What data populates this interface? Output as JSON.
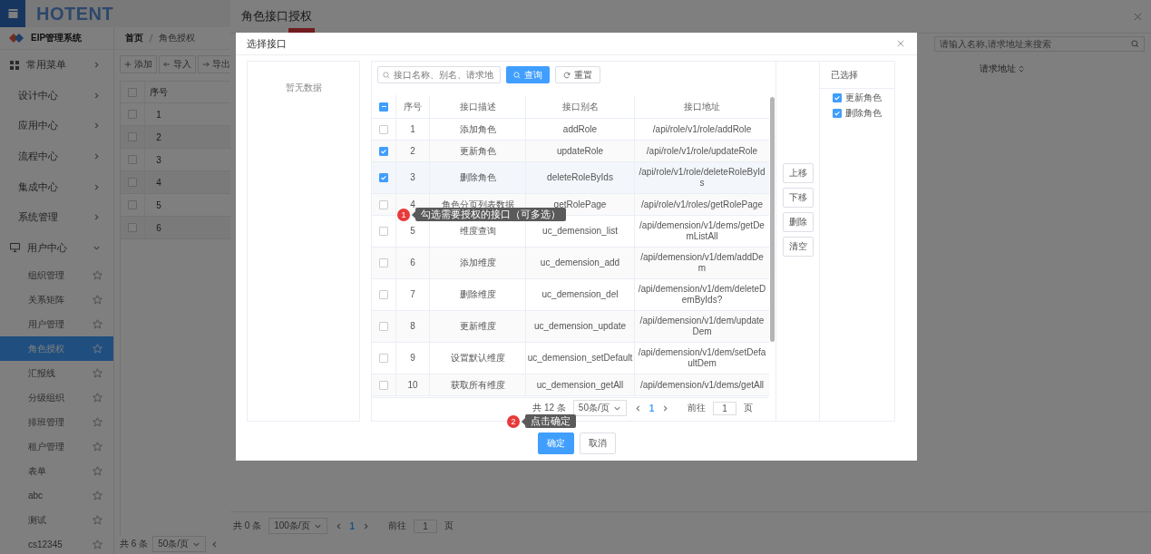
{
  "header": {
    "logo": "HOTENT"
  },
  "sidebar": {
    "system_name": "EIP管理系统",
    "items": [
      {
        "label": "常用菜单",
        "kind": "favorites",
        "expanded": false,
        "selected": false
      },
      {
        "label": "设计中心",
        "kind": "module",
        "expanded": false,
        "selected": false
      },
      {
        "label": "应用中心",
        "kind": "module",
        "expanded": false,
        "selected": false
      },
      {
        "label": "流程中心",
        "kind": "module",
        "expanded": false,
        "selected": false
      },
      {
        "label": "集成中心",
        "kind": "module",
        "expanded": false,
        "selected": false
      },
      {
        "label": "系统管理",
        "kind": "module",
        "expanded": false,
        "selected": false
      },
      {
        "label": "用户中心",
        "kind": "device",
        "expanded": true,
        "selected": false,
        "children": [
          {
            "label": "组织管理",
            "selected": false
          },
          {
            "label": "关系矩阵",
            "selected": false
          },
          {
            "label": "用户管理",
            "selected": false
          },
          {
            "label": "角色授权",
            "selected": true
          },
          {
            "label": "汇报线",
            "selected": false
          },
          {
            "label": "分级组织",
            "selected": false
          },
          {
            "label": "排班管理",
            "selected": false
          },
          {
            "label": "租户管理",
            "selected": false
          },
          {
            "label": "表单",
            "selected": false
          },
          {
            "label": "abc",
            "selected": false
          },
          {
            "label": "测试",
            "selected": false
          },
          {
            "label": "cs12345",
            "selected": false
          }
        ]
      }
    ]
  },
  "main": {
    "breadcrumb": [
      "首页",
      "角色授权"
    ],
    "toolbar": [
      {
        "label": "添加",
        "kind": "add"
      },
      {
        "label": "导入",
        "kind": "import"
      },
      {
        "label": "导出",
        "kind": "export"
      }
    ],
    "table": {
      "columns": [
        "序号"
      ],
      "select_all_checked": false,
      "rows": [
        {
          "index": "1",
          "checked": false
        },
        {
          "index": "2",
          "checked": false
        },
        {
          "index": "3",
          "checked": false
        },
        {
          "index": "4",
          "checked": false
        },
        {
          "index": "5",
          "checked": false
        },
        {
          "index": "6",
          "checked": false
        }
      ]
    },
    "pagination": {
      "total": "共 6 条",
      "page_size": "50条/页"
    }
  },
  "drawer": {
    "title": "角色接口授权",
    "search": {
      "placeholder": "请输入名称,请求地址来搜索"
    },
    "columns": [
      {
        "label": "请求地址",
        "sortable": true
      }
    ],
    "pagination": {
      "total": "共 0 条",
      "page_size": "100条/页",
      "current_page": "1",
      "goto_label": "前往",
      "goto_value": "1",
      "page_unit": "页"
    }
  },
  "dialog": {
    "title": "选择接口",
    "left_panel": {
      "empty_text": "暂无数据"
    },
    "search": {
      "placeholder": "接口名称、别名、请求地"
    },
    "query_button": "查询",
    "reset_button": "重置",
    "table": {
      "select_all_indeterminate": true,
      "columns": [
        "序号",
        "接口描述",
        "接口别名",
        "接口地址"
      ],
      "rows": [
        {
          "index": "1",
          "description": "添加角色",
          "alias": "addRole",
          "address": "/api/role/v1/role/addRole",
          "checked": false
        },
        {
          "index": "2",
          "description": "更新角色",
          "alias": "updateRole",
          "address": "/api/role/v1/role/updateRole",
          "checked": true
        },
        {
          "index": "3",
          "description": "删除角色",
          "alias": "deleteRoleByIds",
          "address": "/api/role/v1/role/deleteRoleByIds",
          "checked": true
        },
        {
          "index": "4",
          "description": "角色分页列表数据",
          "alias": "getRolePage",
          "address": "/api/role/v1/roles/getRolePage",
          "checked": false
        },
        {
          "index": "5",
          "description": "维度查询",
          "alias": "uc_demension_list",
          "address": "/api/demension/v1/dems/getDemListAll",
          "checked": false
        },
        {
          "index": "6",
          "description": "添加维度",
          "alias": "uc_demension_add",
          "address": "/api/demension/v1/dem/addDem",
          "checked": false
        },
        {
          "index": "7",
          "description": "删除维度",
          "alias": "uc_demension_del",
          "address": "/api/demension/v1/dem/deleteDemByIds?",
          "checked": false
        },
        {
          "index": "8",
          "description": "更新维度",
          "alias": "uc_demension_update",
          "address": "/api/demension/v1/dem/updateDem",
          "checked": false
        },
        {
          "index": "9",
          "description": "设置默认维度",
          "alias": "uc_demension_setDefault",
          "address": "/api/demension/v1/dem/setDefaultDem",
          "checked": false
        },
        {
          "index": "10",
          "description": "获取所有维度",
          "alias": "uc_demension_getAll",
          "address": "/api/demension/v1/dems/getAll",
          "checked": false
        }
      ]
    },
    "pagination": {
      "total": "共 12 条",
      "page_size": "50条/页",
      "current_page": "1",
      "goto_label": "前往",
      "goto_value": "1",
      "page_unit": "页"
    },
    "move_buttons": [
      "上移",
      "下移",
      "删除",
      "清空"
    ],
    "selected_panel": {
      "title": "已选择",
      "items": [
        {
          "label": "更新角色",
          "checked": true
        },
        {
          "label": "删除角色",
          "checked": true
        }
      ]
    },
    "footer_buttons": [
      {
        "label": "确定",
        "kind": "primary"
      },
      {
        "label": "取消",
        "kind": "default"
      }
    ]
  },
  "guides": [
    {
      "number": "1",
      "text": "勾选需要授权的接口（可多选）"
    },
    {
      "number": "2",
      "text": "点击确定"
    }
  ]
}
